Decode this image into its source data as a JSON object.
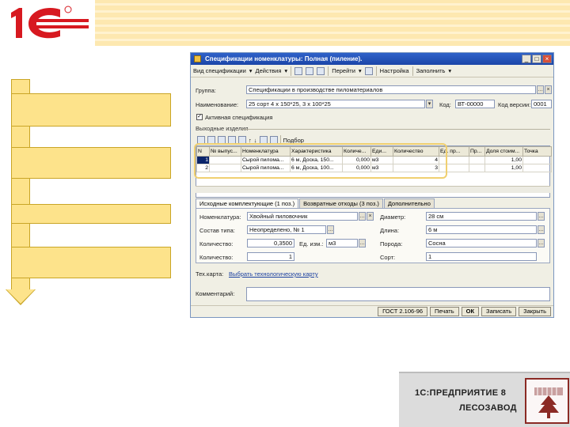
{
  "colors": {
    "brand_red": "#d71920",
    "accent_yellow": "#fde38b",
    "titlebar_blue": "#1b45a8",
    "emblem_red": "#8b2a25"
  },
  "slide": {
    "logo_text": "1С",
    "footer_title": "1С:ПРЕДПРИЯТИЕ 8",
    "footer_subtitle": "ЛЕСОЗАВОД"
  },
  "window": {
    "title": "Спецификации номенклатуры: Полная (пиление).",
    "toolbar": {
      "kind_label": "Вид спецификации",
      "actions_label": "Действия",
      "goto_label": "Перейти",
      "settings_label": "Настройка",
      "fill_label": "Заполнить"
    },
    "form": {
      "group_label": "Группа:",
      "group_value": "Спецификации в производстве пиломатериалов",
      "name_label": "Наименование:",
      "name_value": "25 сорт 4 х 150*25, 3 х 100*25",
      "code_label": "Код:",
      "code_value": "ВТ-00000",
      "weight_label": "Код версии:",
      "weight_value": "0001",
      "active_label": "Активная спецификация",
      "output_section": "Выходные изделия",
      "pick_label": "Подбор"
    },
    "grid": {
      "columns": [
        "N",
        "№ выпус...",
        "Номенклатура",
        "Характеристика",
        "Количе...",
        "Еди...",
        "Количество",
        "Ед. пр...",
        "Пр...",
        "Доля стоим...",
        "Точка"
      ],
      "rows": [
        [
          "1",
          "",
          "Сырой пилома...",
          "6 м, Доска, 150...",
          "0,000",
          "м3",
          "4",
          "",
          "",
          "1,00",
          ""
        ],
        [
          "2",
          "",
          "Сырой пилома...",
          "6 м, Доска, 100...",
          "0,000",
          "м3",
          "3",
          "",
          "",
          "1,00",
          ""
        ]
      ]
    },
    "tabs": [
      "Исходные комплектующие (1 поз.)",
      "Возвратные отходы (3 поз.)",
      "Дополнительно"
    ],
    "detail": {
      "nomenclature_label": "Номенклатура:",
      "nomenclature_value": "Хвойный пиловочник",
      "composition_label": "Состав типа:",
      "composition_value": "Неопределено, № 1",
      "quantity_label": "Количество:",
      "quantity_value": "0,3500",
      "unit_label": "Ед. изм.:",
      "unit_value": "м3",
      "count_label": "Количество:",
      "count_value": "1",
      "diameter_label": "Диаметр:",
      "diameter_value": "28 см",
      "length_label": "Длина:",
      "length_value": "6 м",
      "species_label": "Порода:",
      "species_value": "Сосна",
      "grade_label": "Сорт:",
      "grade_value": "1"
    },
    "tech_map_label": "Тех.карта:",
    "tech_map_value": "Выбрать технологическую карту",
    "comment_label": "Комментарий:",
    "comment_value": "",
    "bottom": {
      "standard_label": "ГОСТ 2.106-96",
      "print_label": "Печать",
      "ok_label": "ОК",
      "save_label": "Записать",
      "close_label": "Закрыть"
    }
  }
}
